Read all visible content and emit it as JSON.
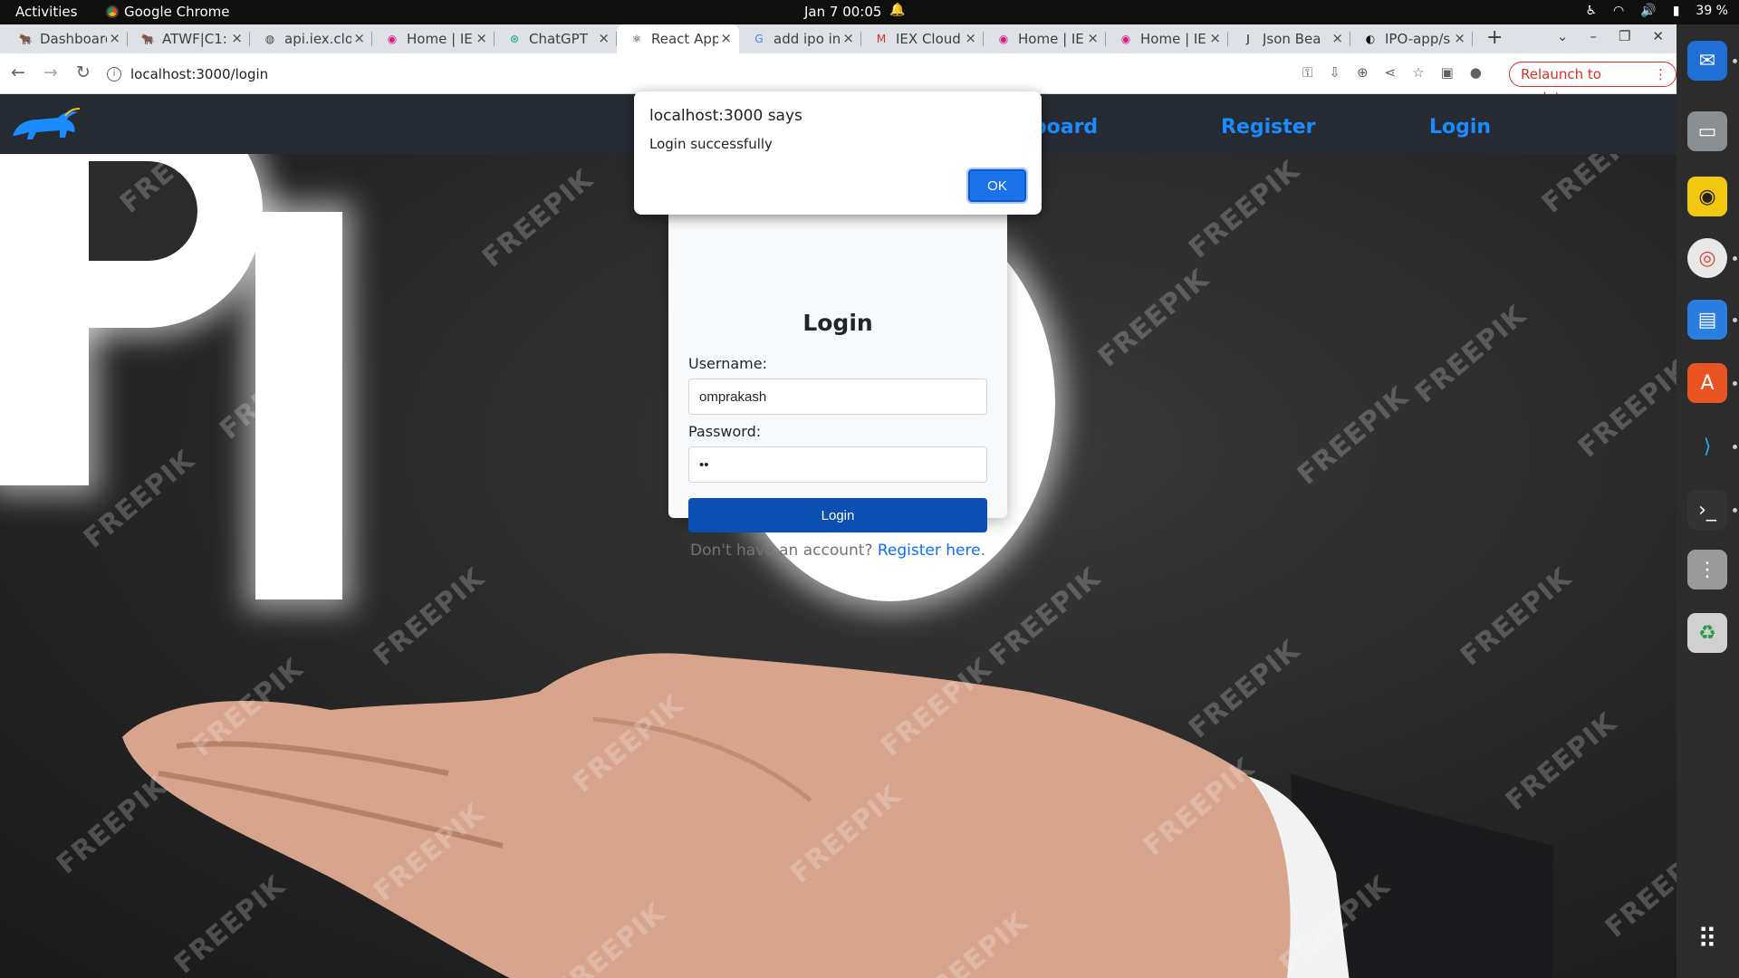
{
  "topbar": {
    "activities": "Activities",
    "app_name": "Google Chrome",
    "clock": "Jan 7  00:05",
    "battery": "39 %"
  },
  "tabs": [
    {
      "title": "Dashboard",
      "icon": "bull-icon",
      "active": false
    },
    {
      "title": "ATWF|C1:",
      "icon": "bull-icon",
      "active": false
    },
    {
      "title": "api.iex.clo",
      "icon": "globe-icon",
      "active": false
    },
    {
      "title": "Home | IE",
      "icon": "iex-icon",
      "active": false
    },
    {
      "title": "ChatGPT",
      "icon": "chatgpt-icon",
      "active": false
    },
    {
      "title": "React App",
      "icon": "react-icon",
      "active": true
    },
    {
      "title": "add ipo in",
      "icon": "google-icon",
      "active": false
    },
    {
      "title": "IEX Cloud",
      "icon": "gmail-icon",
      "active": false
    },
    {
      "title": "Home | IE",
      "icon": "iex-icon",
      "active": false
    },
    {
      "title": "Home | IE",
      "icon": "iex-icon",
      "active": false
    },
    {
      "title": "Json Bea",
      "icon": "json-icon",
      "active": false
    },
    {
      "title": "IPO-app/s",
      "icon": "github-icon",
      "active": false
    }
  ],
  "toolbar": {
    "url": "localhost:3000/login",
    "relaunch_label": "Relaunch to update"
  },
  "app": {
    "nav": {
      "dashboard": "Dashboard",
      "register": "Register",
      "login": "Login"
    },
    "watermark": "FREEPIK",
    "background_text": "IPO",
    "login_form": {
      "title": "Login",
      "username_label": "Username:",
      "username_value": "omprakash",
      "password_label": "Password:",
      "password_value": "••",
      "submit_label": "Login",
      "register_prompt": "Don't have an account?",
      "register_link": "Register here"
    }
  },
  "dialog": {
    "title": "localhost:3000 says",
    "message": "Login successfully",
    "ok_label": "OK"
  },
  "dock": [
    "thunderbird-icon",
    "files-icon",
    "rhythmbox-icon",
    "chrome-icon",
    "writer-icon",
    "software-icon",
    "vscode-icon",
    "terminal-icon",
    "disks-icon",
    "trash-icon",
    "app-grid-icon"
  ],
  "colors": {
    "nav_link": "#1a8cff",
    "login_button": "#0b4fb3",
    "dialog_ok": "#1a73e8",
    "relaunch": "#d93025"
  }
}
